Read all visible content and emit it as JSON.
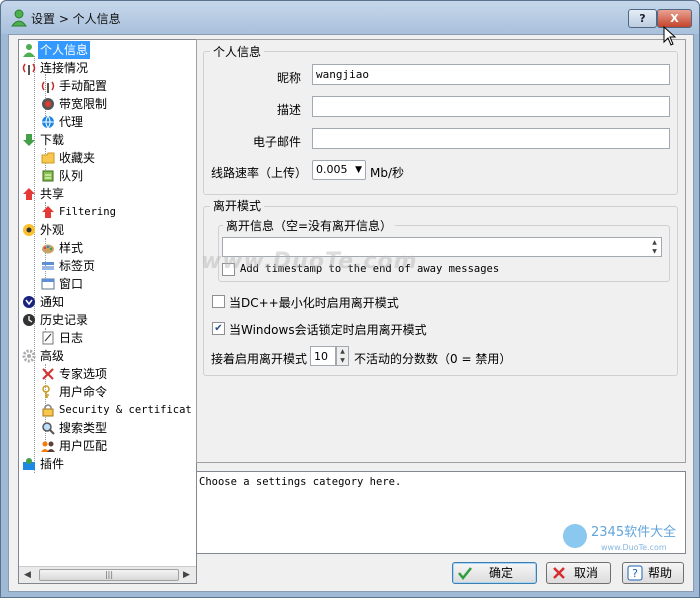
{
  "window": {
    "title": "设置 > 个人信息",
    "help_button": "?",
    "close_button": "X"
  },
  "tree": [
    {
      "label": "个人信息",
      "selected": true
    },
    {
      "label": "连接情况"
    },
    {
      "label": "手动配置"
    },
    {
      "label": "带宽限制"
    },
    {
      "label": "代理"
    },
    {
      "label": "下载"
    },
    {
      "label": "收藏夹"
    },
    {
      "label": "队列"
    },
    {
      "label": "共享"
    },
    {
      "label": "Filtering"
    },
    {
      "label": "外观"
    },
    {
      "label": "样式"
    },
    {
      "label": "标签页"
    },
    {
      "label": "窗口"
    },
    {
      "label": "通知"
    },
    {
      "label": "历史记录"
    },
    {
      "label": "日志"
    },
    {
      "label": "高级"
    },
    {
      "label": "专家选项"
    },
    {
      "label": "用户命令"
    },
    {
      "label": "Security & certificat"
    },
    {
      "label": "搜索类型"
    },
    {
      "label": "用户匹配"
    },
    {
      "label": "插件"
    }
  ],
  "personal": {
    "group_title": "个人信息",
    "nick_label": "昵称",
    "nick_value": "wangjiao",
    "desc_label": "描述",
    "desc_value": "",
    "email_label": "电子邮件",
    "email_value": "",
    "speed_label": "线路速率（上传）",
    "speed_value": "0.005",
    "speed_unit": "Mb/秒"
  },
  "away": {
    "group_title": "离开模式",
    "message_group_title": "离开信息（空=没有离开信息）",
    "message_value": "",
    "timestamp_label": "Add timestamp to the end of away messages",
    "timestamp_checked": false,
    "minimize_label": "当DC++最小化时启用离开模式",
    "minimize_checked": false,
    "lock_label": "当Windows会话锁定时启用离开模式",
    "lock_checked": true,
    "idle_prefix": "接着启用离开模式",
    "idle_value": "10",
    "idle_suffix": "不活动的分数数（0 = 禁用）"
  },
  "info_text": "Choose a settings category here.",
  "buttons": {
    "ok": "确定",
    "cancel": "取消",
    "help": "帮助"
  },
  "watermark": "www.DuoTe.com",
  "corner_logo": "2345软件大全",
  "corner_logo_url": "www.DuoTe.com",
  "colors": {
    "selection": "#3399ff",
    "title_bar": "#a9c1dc"
  }
}
